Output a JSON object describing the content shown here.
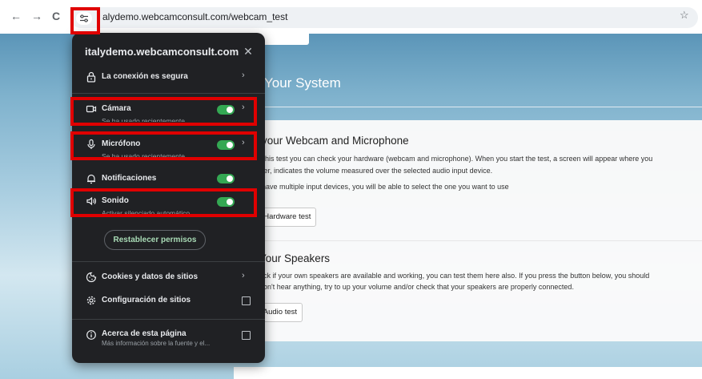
{
  "browser": {
    "back_icon": "arrow-left-icon",
    "forward_icon": "arrow-right-icon",
    "reload_icon": "reload-icon",
    "site_info_icon": "tune-icon",
    "url": "alydemo.webcamconsult.com/webcam_test",
    "bookmark_icon": "star-icon",
    "back_glyph": "←",
    "forward_glyph": "→",
    "reload_glyph": "C",
    "star_glyph": "☆"
  },
  "page": {
    "heading": "Your System",
    "webcam_section": {
      "title": "your Webcam and Microphone",
      "lines": [
        "his test you can check your hardware (webcam and microphone). When you start the test, a screen will appear where you",
        "ter, indicates the volume measured over the selected audio input device.",
        "have multiple input devices, you will be able to select the one you want to use"
      ],
      "button": "t Hardware test"
    },
    "speakers_section": {
      "title": "Your Speakers",
      "lines": [
        "eck if your own speakers are available and working, you can test them here also. If you press the button below, you should",
        "don't hear anything, try to up your volume and/or check that your speakers are properly connected."
      ],
      "button": "t Audio test"
    }
  },
  "popup": {
    "title": "italydemo.webcamconsult.com",
    "close_glyph": "✕",
    "connection": {
      "label": "La conexión es segura",
      "icon": "lock-icon"
    },
    "permissions": [
      {
        "key": "camera",
        "label": "Cámara",
        "sub": "Se ha usado recientemente",
        "icon": "camera-icon",
        "enabled": true,
        "has_chevron": true
      },
      {
        "key": "microphone",
        "label": "Micrófono",
        "sub": "Se ha usado recientemente",
        "icon": "microphone-icon",
        "enabled": true,
        "has_chevron": true
      },
      {
        "key": "notifications",
        "label": "Notificaciones",
        "sub": "",
        "icon": "bell-icon",
        "enabled": true,
        "has_chevron": false
      },
      {
        "key": "sound",
        "label": "Sonido",
        "sub": "Activar silenciado automático",
        "icon": "speaker-icon",
        "enabled": true,
        "has_chevron": false
      }
    ],
    "reset_button": "Restablecer permisos",
    "cookies": {
      "label": "Cookies y datos de sitios",
      "icon": "cookie-icon"
    },
    "site_settings": {
      "label": "Configuración de sitios",
      "icon": "gear-icon"
    },
    "about": {
      "label": "Acerca de esta página",
      "sub": "Más información sobre la fuente y el...",
      "icon": "info-icon"
    },
    "chevron_glyph": "›",
    "toggle_color": "#34a853"
  },
  "highlight_color": "#e00000"
}
